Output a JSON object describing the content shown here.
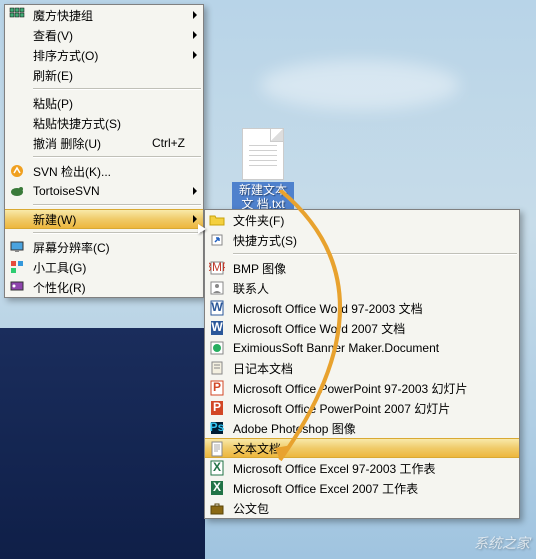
{
  "desktop": {
    "file_label": "新建文本文\n档.txt"
  },
  "main_menu": {
    "items": [
      {
        "icon": "grid",
        "label": "魔方快捷组",
        "arrow": true
      },
      {
        "icon": "",
        "label": "查看(V)",
        "arrow": true
      },
      {
        "icon": "",
        "label": "排序方式(O)",
        "arrow": true
      },
      {
        "icon": "",
        "label": "刷新(E)",
        "arrow": false
      },
      {
        "sep": true
      },
      {
        "icon": "",
        "label": "粘贴(P)",
        "arrow": false
      },
      {
        "icon": "",
        "label": "粘贴快捷方式(S)",
        "arrow": false
      },
      {
        "icon": "",
        "label": "撤消 删除(U)",
        "shortcut": "Ctrl+Z",
        "arrow": false
      },
      {
        "sep": true
      },
      {
        "icon": "svn",
        "label": "SVN 检出(K)...",
        "arrow": false
      },
      {
        "icon": "tortoise",
        "label": "TortoiseSVN",
        "arrow": true
      },
      {
        "sep": true
      },
      {
        "icon": "",
        "label": "新建(W)",
        "arrow": true,
        "highlight": true
      },
      {
        "sep": true
      },
      {
        "icon": "display",
        "label": "屏幕分辨率(C)",
        "arrow": false
      },
      {
        "icon": "gadget",
        "label": "小工具(G)",
        "arrow": false
      },
      {
        "icon": "personalize",
        "label": "个性化(R)",
        "arrow": false
      }
    ]
  },
  "sub_menu": {
    "items": [
      {
        "icon": "folder",
        "label": "文件夹(F)"
      },
      {
        "icon": "shortcut",
        "label": "快捷方式(S)"
      },
      {
        "sep": true
      },
      {
        "icon": "bmp",
        "label": "BMP 图像"
      },
      {
        "icon": "contact",
        "label": "联系人"
      },
      {
        "icon": "word97",
        "label": "Microsoft Office Word 97-2003 文档"
      },
      {
        "icon": "word",
        "label": "Microsoft Office Word 2007 文档"
      },
      {
        "icon": "exim",
        "label": "EximiousSoft Banner Maker.Document"
      },
      {
        "icon": "diary",
        "label": "日记本文档"
      },
      {
        "icon": "ppt97",
        "label": "Microsoft Office PowerPoint 97-2003 幻灯片"
      },
      {
        "icon": "ppt",
        "label": "Microsoft Office PowerPoint 2007 幻灯片"
      },
      {
        "icon": "ps",
        "label": "Adobe Photoshop 图像"
      },
      {
        "icon": "txt",
        "label": "文本文档",
        "highlight": true
      },
      {
        "icon": "xls97",
        "label": "Microsoft Office Excel 97-2003 工作表"
      },
      {
        "icon": "xls",
        "label": "Microsoft Office Excel 2007 工作表"
      },
      {
        "icon": "briefcase",
        "label": "公文包"
      }
    ]
  },
  "watermark": "系统之家"
}
